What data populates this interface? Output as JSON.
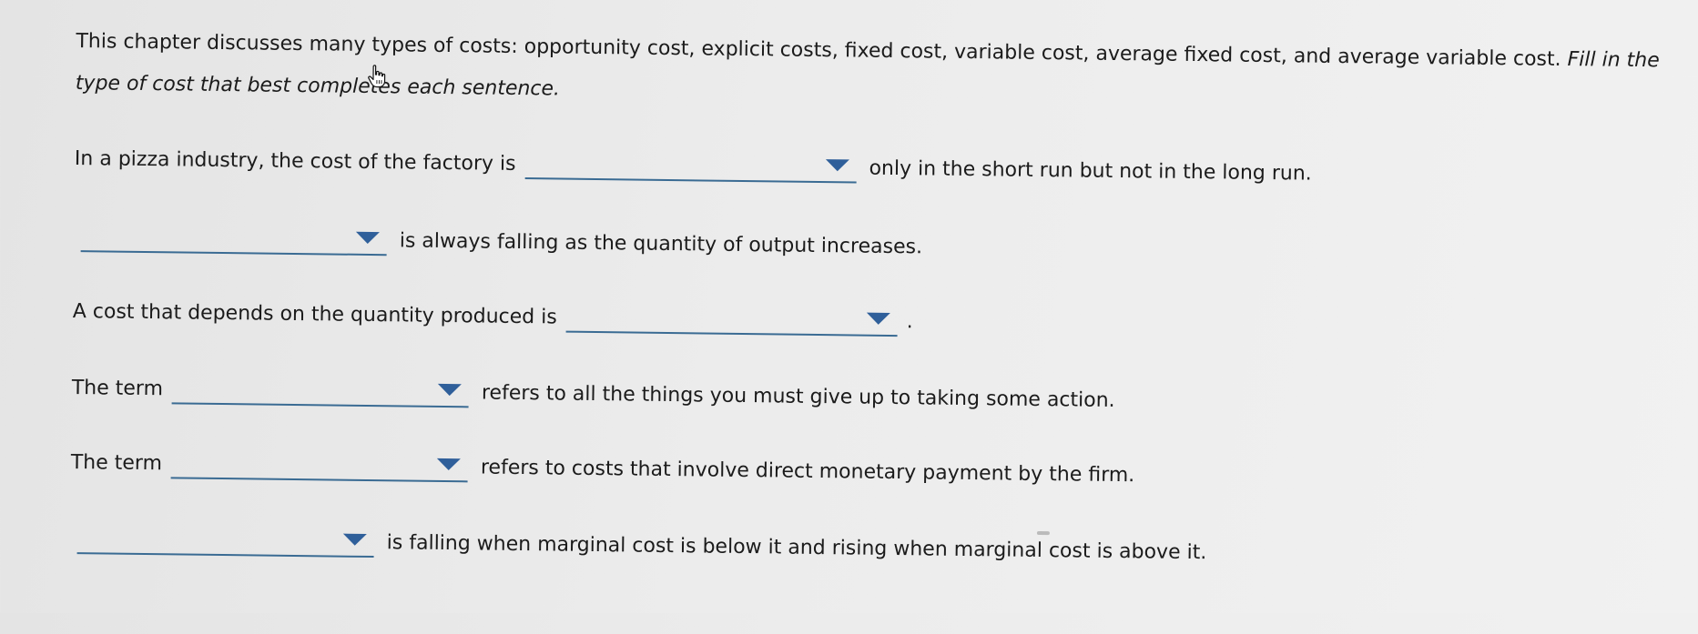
{
  "intro": {
    "normal": "This chapter discusses many types of costs: opportunity cost, explicit costs, fixed cost, variable cost, average fixed cost, and average variable cost. ",
    "italic": "Fill in the type of cost that best completes each sentence."
  },
  "questions": [
    {
      "before": "In a pizza industry, the cost of the factory is",
      "after": "only in the short run but not in the long run.",
      "selected": ""
    },
    {
      "before": "",
      "after": "is always falling as the quantity of output increases.",
      "selected": ""
    },
    {
      "before": "A cost that depends on the quantity produced is",
      "after": ".",
      "selected": ""
    },
    {
      "before": "The term",
      "after": "refers to all the things you must give up to taking some action.",
      "selected": ""
    },
    {
      "before": "The term",
      "after": "refers to costs that involve direct monetary payment by the firm.",
      "selected": ""
    },
    {
      "before": "",
      "after": "is falling when marginal cost is below it and rising when marginal cost is above it.",
      "selected": ""
    }
  ],
  "icons": {
    "dropdown": "chevron-down-icon",
    "cursor": "hand-pointer-icon"
  },
  "colors": {
    "dropdown_line": "#3a6b93",
    "dropdown_caret": "#2f5f9a",
    "text": "#1b1b1b",
    "background": "#ececec"
  }
}
